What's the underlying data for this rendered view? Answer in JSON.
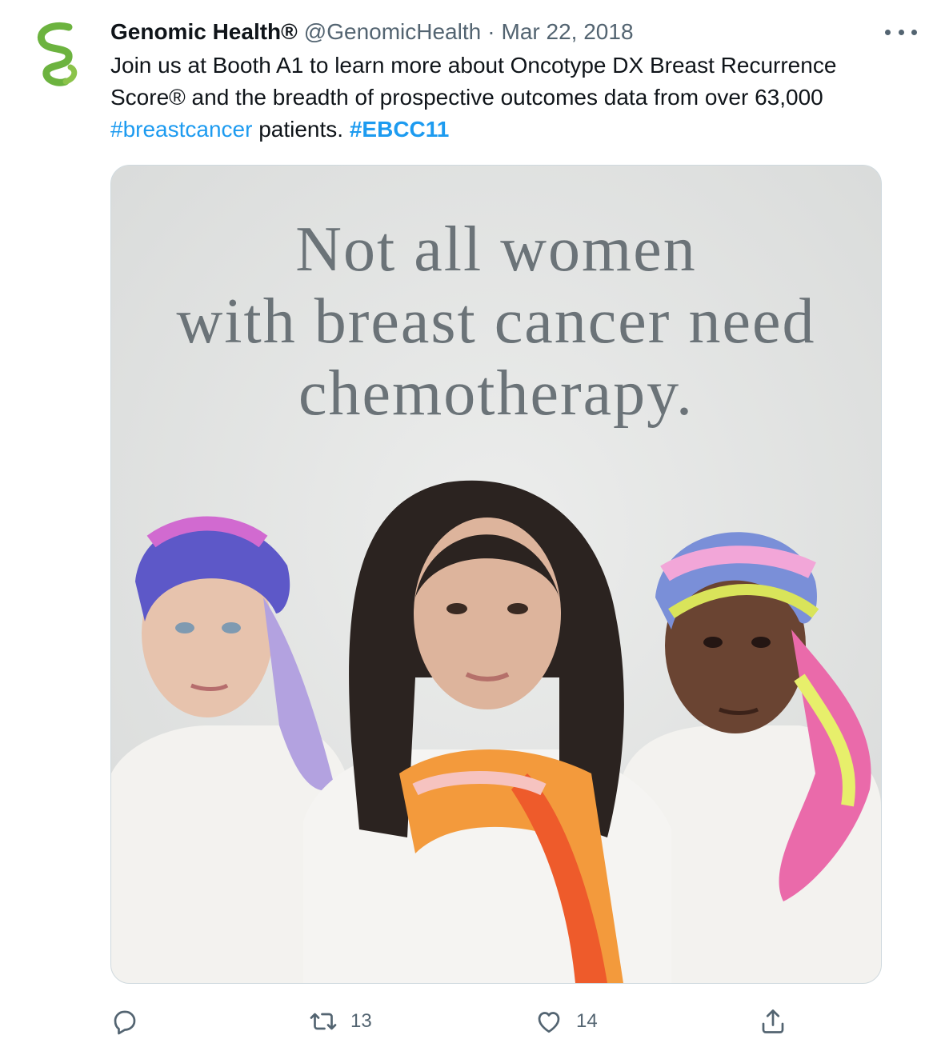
{
  "tweet": {
    "author": {
      "display_name": "Genomic Health®",
      "handle": "@GenomicHealth",
      "avatar_icon": "genomic-health-logo-icon",
      "avatar_color": "#6cb33f"
    },
    "separator": "·",
    "date": "Mar 22, 2018",
    "text": {
      "line1": "Join us at Booth A1 to learn more about Oncotype DX Breast Recurrence",
      "line2": "Score® and the breadth of prospective outcomes data from over 63,000",
      "hashtag1": "#breastcancer",
      "middle": " patients. ",
      "hashtag2": "#EBCC11"
    },
    "media": {
      "headline_line1": "Not all women",
      "headline_line2": "with breast cancer need",
      "headline_line3": "chemotherapy."
    },
    "actions": {
      "reply_icon": "reply-icon",
      "retweet_icon": "retweet-icon",
      "retweet_count": "13",
      "like_icon": "heart-icon",
      "like_count": "14",
      "share_icon": "share-icon"
    },
    "colors": {
      "link": "#1d9bf0",
      "secondary_text": "#536471",
      "headline_gray": "#6b7378"
    }
  }
}
